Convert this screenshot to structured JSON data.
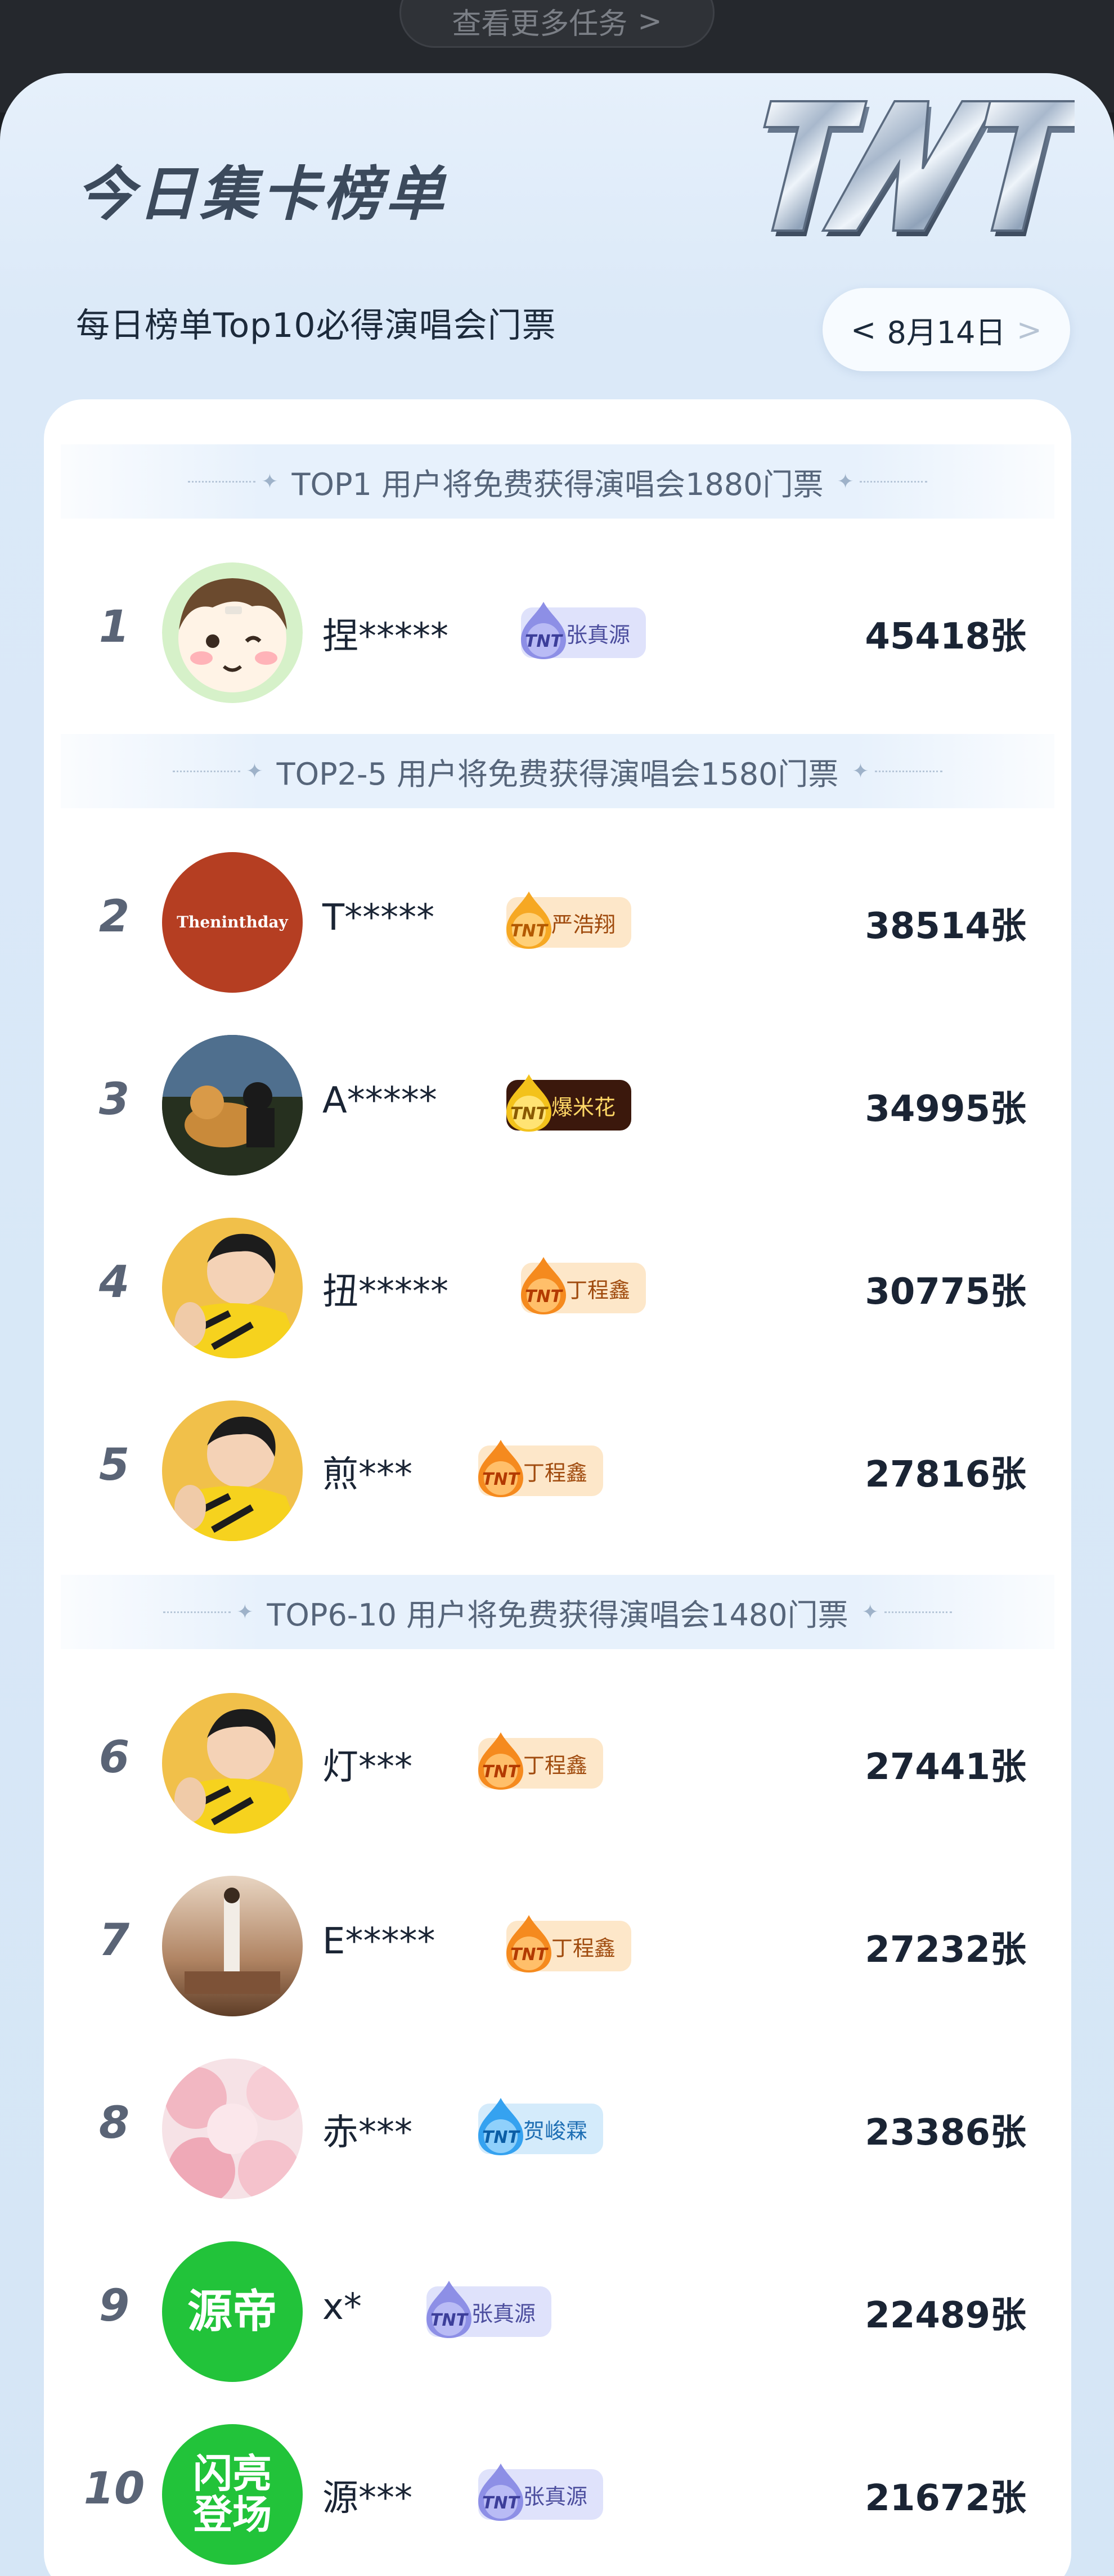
{
  "top_bar": {
    "more_tasks_label": "查看更多任务",
    "more_tasks_arrow": ">"
  },
  "panel": {
    "title": "今日集卡榜单",
    "logo_text": "TNT",
    "subtitle": "每日榜单Top10必得演唱会门票",
    "date": {
      "prev": "<",
      "label": "8月14日",
      "next": ">"
    }
  },
  "tiers": [
    {
      "label": "TOP1 用户将免费获得演唱会1880门票"
    },
    {
      "label": "TOP2-5 用户将免费获得演唱会1580门票"
    },
    {
      "label": "TOP6-10 用户将免费获得演唱会1480门票"
    }
  ],
  "rows": [
    {
      "rank": "1",
      "name": "捏*****",
      "badge": "张真源",
      "badge_style": "purple",
      "count": "45418张",
      "avatar": "cartoon-boy"
    },
    {
      "rank": "2",
      "name": "T*****",
      "badge": "严浩翔",
      "badge_style": "orange",
      "count": "38514张",
      "avatar": "theninthday",
      "avatar_text": "Theninthday"
    },
    {
      "rank": "3",
      "name": "A*****",
      "badge": "爆米花",
      "badge_style": "brown",
      "count": "34995张",
      "avatar": "dog-photo"
    },
    {
      "rank": "4",
      "name": "扭*****",
      "badge": "丁程鑫",
      "badge_style": "orange",
      "count": "30775张",
      "avatar": "yellow-portrait"
    },
    {
      "rank": "5",
      "name": "煎***",
      "badge": "丁程鑫",
      "badge_style": "orange",
      "count": "27816张",
      "avatar": "yellow-portrait"
    },
    {
      "rank": "6",
      "name": "灯***",
      "badge": "丁程鑫",
      "badge_style": "orange",
      "count": "27441张",
      "avatar": "yellow-portrait"
    },
    {
      "rank": "7",
      "name": "E*****",
      "badge": "丁程鑫",
      "badge_style": "orange",
      "count": "27232张",
      "avatar": "stage-photo"
    },
    {
      "rank": "8",
      "name": "赤***",
      "badge": "贺峻霖",
      "badge_style": "blue",
      "count": "23386张",
      "avatar": "pink-floral"
    },
    {
      "rank": "9",
      "name": "x*",
      "badge": "张真源",
      "badge_style": "purple",
      "count": "22489张",
      "avatar": "green-text",
      "avatar_text": "源帝"
    },
    {
      "rank": "10",
      "name": "源***",
      "badge": "张真源",
      "badge_style": "purple",
      "count": "21672张",
      "avatar": "green-text",
      "avatar_text_lines": [
        "闪亮",
        "登场"
      ]
    }
  ],
  "colors": {
    "panel_bg": "#dbe9f8",
    "card_bg": "#ffffff",
    "tier_banner": "#e7f1fc",
    "badge_purple": "#dfe2fb",
    "badge_orange": "#fde7c9",
    "badge_brown": "#3b180c",
    "badge_blue": "#d4ebfb",
    "green_avatar": "#22c33a"
  }
}
